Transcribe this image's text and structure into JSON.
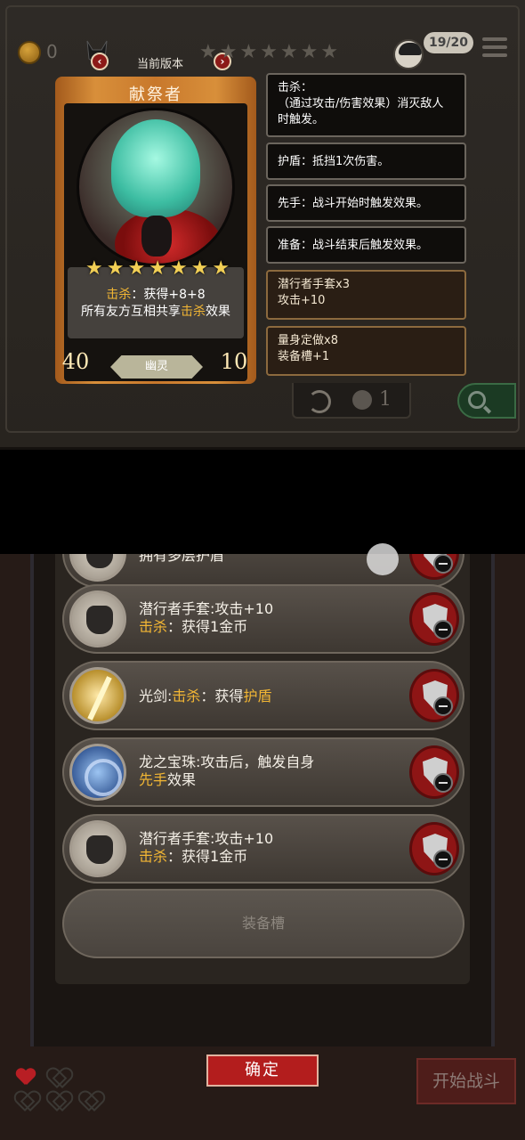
{
  "header": {
    "coins": "0",
    "version_label": "当前版本",
    "stars_total": 7,
    "lives_counter": "19/20"
  },
  "hero_card": {
    "name": "献祭者",
    "stars": 7,
    "desc_keyword": "击杀",
    "desc_line1_rest": "：获得+8+8",
    "desc_line2_pre": "所有友方互相共享",
    "desc_line2_keyword": "击杀",
    "desc_line2_post": "效果",
    "attack": "40",
    "health": "10",
    "type": "幽灵"
  },
  "keywords": [
    {
      "title": "击杀：",
      "text": "（通过攻击/伤害效果）消灭敌人时触发。"
    },
    {
      "text": "护盾：抵挡1次伤害。"
    },
    {
      "text": "先手：战斗开始时触发效果。"
    },
    {
      "text": "准备：战斗结束后触发效果。"
    }
  ],
  "item_boxes": [
    {
      "title": "潜行者手套x3",
      "text": "攻击+10"
    },
    {
      "title": "量身定做x8",
      "text": "装备槽+1"
    }
  ],
  "refresh": {
    "count": "1"
  },
  "equipment": {
    "partial_text": "拥有多层护盾",
    "items": [
      {
        "name": "潜行者手套",
        "line1": "潜行者手套:攻击+10",
        "kw": "击杀",
        "line2_rest": "：获得1金币",
        "icon": "glove-icon"
      },
      {
        "name": "光剑",
        "line1_pre": "光剑:",
        "kw": "击杀",
        "mid": "：获得",
        "kw2": "护盾",
        "icon": "saber-icon"
      },
      {
        "name": "龙之宝珠",
        "line1": "龙之宝珠:攻击后，触发自身",
        "kw": "先手",
        "line2_rest": "效果",
        "icon": "orb-icon"
      },
      {
        "name": "潜行者手套",
        "line1": "潜行者手套:攻击+10",
        "kw": "击杀",
        "line2_rest": "：获得1金币",
        "icon": "glove-icon"
      }
    ],
    "empty_slot_label": "装备槽"
  },
  "footer": {
    "confirm_label": "确定",
    "start_battle_label": "开始战斗",
    "hearts_full": 1,
    "hearts_total": 5
  },
  "colors": {
    "keyword": "#f2b634",
    "confirm": "#b31d1d"
  }
}
